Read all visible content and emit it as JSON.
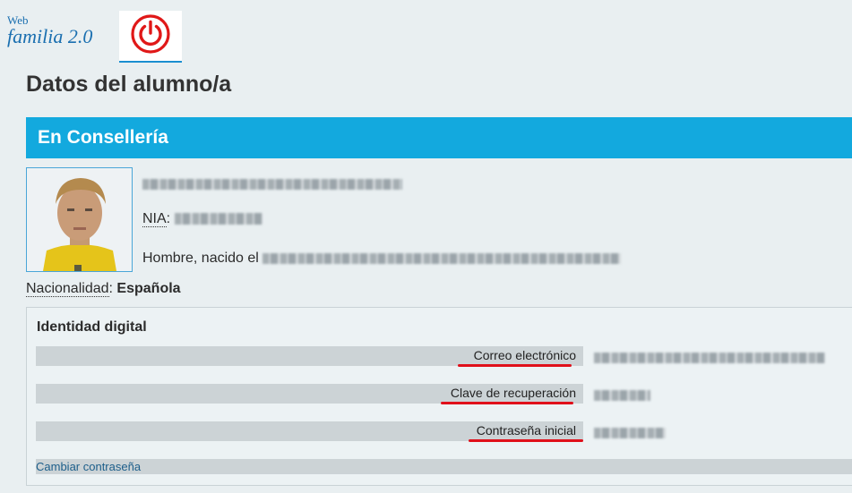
{
  "brand": {
    "top_text": "Web",
    "main_text": "familia 2.0"
  },
  "header": {
    "logout_icon": "power-icon"
  },
  "page": {
    "title": "Datos del alumno/a"
  },
  "section": {
    "title": "En Consellería"
  },
  "student": {
    "nia_label": "NIA",
    "born_text": "Hombre, nacido el",
    "nationality_label": "Nacionalidad",
    "nationality_value": "Española"
  },
  "identity": {
    "title": "Identidad digital",
    "rows": [
      {
        "label": "Correo electrónico"
      },
      {
        "label": "Clave de recuperación"
      },
      {
        "label": "Contraseña inicial"
      }
    ],
    "change_password": "Cambiar contraseña"
  },
  "colors": {
    "accent": "#13a9de",
    "highlight": "#e0101a"
  }
}
